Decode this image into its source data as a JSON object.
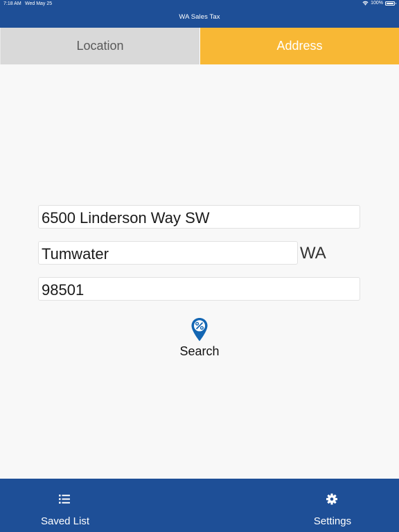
{
  "status_bar": {
    "time": "7:18 AM",
    "date": "Wed May 25",
    "battery": "100%",
    "battery_level": 1.0
  },
  "nav": {
    "title": "WA Sales Tax"
  },
  "tabs": [
    {
      "label": "Location",
      "selected": false
    },
    {
      "label": "Address",
      "selected": true
    }
  ],
  "form": {
    "street": {
      "value": "6500 Linderson Way SW"
    },
    "city": {
      "value": "Tumwater"
    },
    "state": "WA",
    "zip": {
      "value": "98501"
    }
  },
  "search": {
    "label": "Search",
    "icon": "map-pin-percent-icon"
  },
  "bottom_bar": {
    "saved_list": {
      "label": "Saved List",
      "icon": "list-icon"
    },
    "settings": {
      "label": "Settings",
      "icon": "gear-icon"
    }
  },
  "colors": {
    "bar_blue": "#1e4f97",
    "selected_tab": "#f8b835",
    "unselected_tab": "#d9d9d9",
    "pin_blue": "#1366b3",
    "background": "#f8f8f8"
  }
}
